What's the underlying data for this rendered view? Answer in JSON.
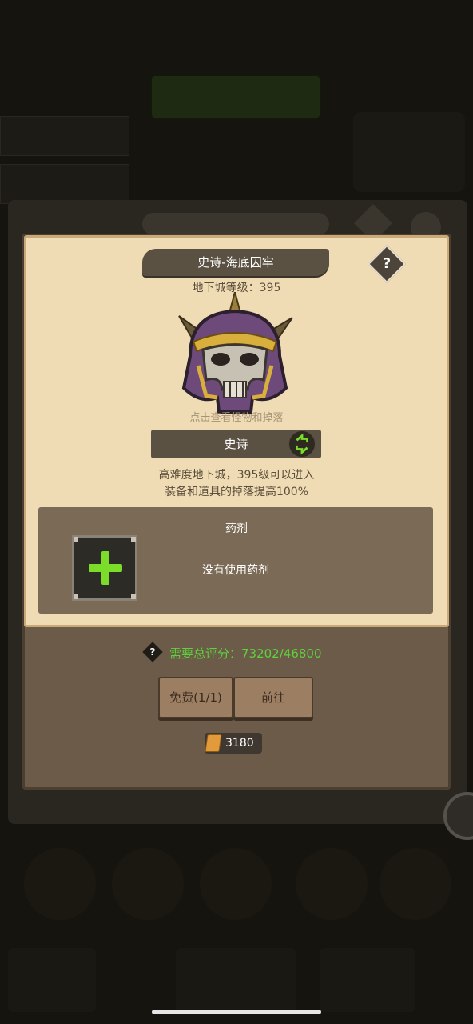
{
  "dialog": {
    "title": "史诗-海底囚牢",
    "help_mark": "?",
    "level_text": "地下城等级：395",
    "view_hint": "点击查看怪物和掉落",
    "difficulty": "史诗",
    "description": [
      "高难度地下城，395级可以进入",
      "装备和道具的掉落提高100%"
    ],
    "potion": {
      "title": "药剂",
      "empty_text": "没有使用药剂"
    },
    "score": {
      "help_mark": "?",
      "text": "需要总评分：73202/46800",
      "color": "#5ed13c"
    },
    "buttons": {
      "free_label": "免费(1/1)",
      "go_label": "前往"
    },
    "cost": {
      "icon": "scroll-icon",
      "value": "3180"
    }
  },
  "colors": {
    "parchment": "#efdcb4",
    "panel": "#6b5b48",
    "plus_green": "#7bdc2a"
  }
}
